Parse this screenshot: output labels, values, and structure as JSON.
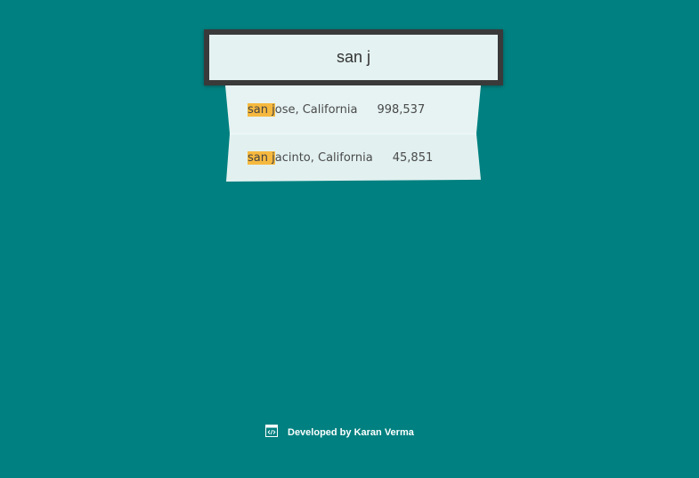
{
  "search": {
    "value": "san j"
  },
  "suggestions": [
    {
      "match": "san j",
      "rest": "ose, California",
      "population": "998,537"
    },
    {
      "match": "san j",
      "rest": "acinto, California",
      "population": "45,851"
    }
  ],
  "footer": {
    "icon": "code-window-icon",
    "text": "Developed by Karan Verma"
  },
  "colors": {
    "background": "#008080",
    "highlight": "#f6b93f",
    "panel": "#e4f2f1",
    "border": "#3a3a3a"
  }
}
